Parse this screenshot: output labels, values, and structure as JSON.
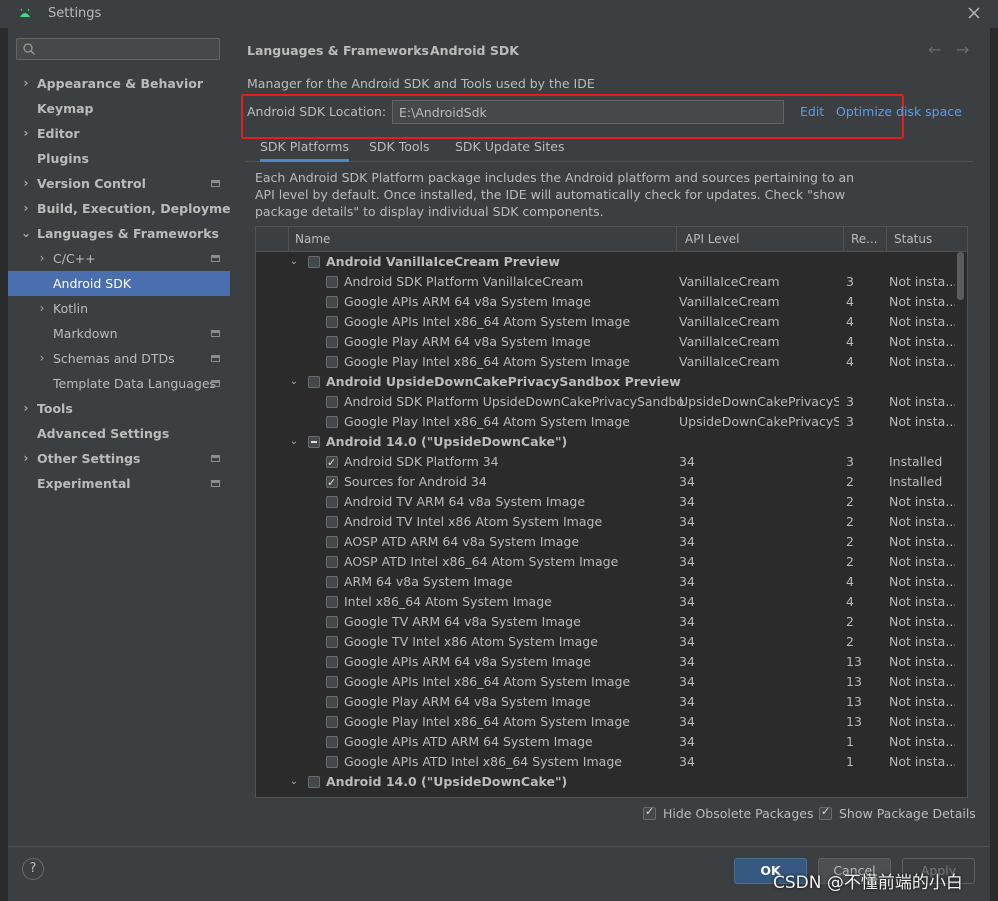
{
  "window": {
    "title": "Settings"
  },
  "search": {
    "placeholder": "",
    "value": ""
  },
  "sidebar": {
    "items": [
      {
        "label": "Appearance & Behavior",
        "level": 0,
        "bold": true,
        "expander": "›",
        "pin": false,
        "selected": false
      },
      {
        "label": "Keymap",
        "level": 0,
        "bold": true,
        "expander": "",
        "pin": false,
        "selected": false
      },
      {
        "label": "Editor",
        "level": 0,
        "bold": true,
        "expander": "›",
        "pin": false,
        "selected": false
      },
      {
        "label": "Plugins",
        "level": 0,
        "bold": true,
        "expander": "",
        "pin": false,
        "selected": false
      },
      {
        "label": "Version Control",
        "level": 0,
        "bold": true,
        "expander": "›",
        "pin": true,
        "selected": false
      },
      {
        "label": "Build, Execution, Deployment",
        "level": 0,
        "bold": true,
        "expander": "›",
        "pin": false,
        "selected": false
      },
      {
        "label": "Languages & Frameworks",
        "level": 0,
        "bold": true,
        "expander": "⌄",
        "pin": false,
        "selected": false
      },
      {
        "label": "C/C++",
        "level": 1,
        "bold": false,
        "expander": "›",
        "pin": true,
        "selected": false
      },
      {
        "label": "Android SDK",
        "level": 1,
        "bold": false,
        "expander": "",
        "pin": false,
        "selected": true
      },
      {
        "label": "Kotlin",
        "level": 1,
        "bold": false,
        "expander": "›",
        "pin": false,
        "selected": false
      },
      {
        "label": "Markdown",
        "level": 1,
        "bold": false,
        "expander": "",
        "pin": true,
        "selected": false
      },
      {
        "label": "Schemas and DTDs",
        "level": 1,
        "bold": false,
        "expander": "›",
        "pin": true,
        "selected": false
      },
      {
        "label": "Template Data Languages",
        "level": 1,
        "bold": false,
        "expander": "",
        "pin": true,
        "selected": false
      },
      {
        "label": "Tools",
        "level": 0,
        "bold": true,
        "expander": "›",
        "pin": false,
        "selected": false
      },
      {
        "label": "Advanced Settings",
        "level": 0,
        "bold": true,
        "expander": "",
        "pin": false,
        "selected": false
      },
      {
        "label": "Other Settings",
        "level": 0,
        "bold": true,
        "expander": "›",
        "pin": true,
        "selected": false
      },
      {
        "label": "Experimental",
        "level": 0,
        "bold": true,
        "expander": "",
        "pin": true,
        "selected": false
      }
    ]
  },
  "breadcrumb": {
    "parent": "Languages & Frameworks",
    "separator": "›",
    "current": "Android SDK"
  },
  "header": {
    "back_icon": "←",
    "forward_icon": "→"
  },
  "sdk": {
    "description": "Manager for the Android SDK and Tools used by the IDE",
    "location_label": "Android SDK Location:",
    "location_value": "E:\\AndroidSdk",
    "edit_link": "Edit",
    "optimize_link": "Optimize disk space"
  },
  "tabs": [
    {
      "label": "SDK Platforms",
      "active": true
    },
    {
      "label": "SDK Tools",
      "active": false
    },
    {
      "label": "SDK Update Sites",
      "active": false
    }
  ],
  "info_text": "Each Android SDK Platform package includes the Android platform and sources pertaining to an API level by default. Once installed, the IDE will automatically check for updates. Check \"show package details\" to display individual SDK components.",
  "table": {
    "columns": {
      "name": "Name",
      "api": "API Level",
      "rev": "Re...",
      "status": "Status"
    },
    "rows": [
      {
        "type": "group",
        "name": "Android VanillaIceCream Preview",
        "check": "none"
      },
      {
        "type": "item",
        "name": "Android SDK Platform VanillaIceCream",
        "api": "VanillaIceCream",
        "rev": "3",
        "status": "Not insta...",
        "check": "none"
      },
      {
        "type": "item",
        "name": "Google APIs ARM 64 v8a System Image",
        "api": "VanillaIceCream",
        "rev": "4",
        "status": "Not insta...",
        "check": "none"
      },
      {
        "type": "item",
        "name": "Google APIs Intel x86_64 Atom System Image",
        "api": "VanillaIceCream",
        "rev": "4",
        "status": "Not insta...",
        "check": "none"
      },
      {
        "type": "item",
        "name": "Google Play ARM 64 v8a System Image",
        "api": "VanillaIceCream",
        "rev": "4",
        "status": "Not insta...",
        "check": "none"
      },
      {
        "type": "item",
        "name": "Google Play Intel x86_64 Atom System Image",
        "api": "VanillaIceCream",
        "rev": "4",
        "status": "Not insta...",
        "check": "none"
      },
      {
        "type": "group",
        "name": "Android UpsideDownCakePrivacySandbox Preview",
        "check": "none"
      },
      {
        "type": "item",
        "name": "Android SDK Platform UpsideDownCakePrivacySandbox",
        "api": "UpsideDownCakePrivacyS...",
        "rev": "3",
        "status": "Not insta...",
        "check": "none"
      },
      {
        "type": "item",
        "name": "Google Play Intel x86_64 Atom System Image",
        "api": "UpsideDownCakePrivacyS...",
        "rev": "3",
        "status": "Not insta...",
        "check": "none"
      },
      {
        "type": "group",
        "name": "Android 14.0 (\"UpsideDownCake\")",
        "check": "partial"
      },
      {
        "type": "item",
        "name": "Android SDK Platform 34",
        "api": "34",
        "rev": "3",
        "status": "Installed",
        "check": "checked"
      },
      {
        "type": "item",
        "name": "Sources for Android 34",
        "api": "34",
        "rev": "2",
        "status": "Installed",
        "check": "checked"
      },
      {
        "type": "item",
        "name": "Android TV ARM 64 v8a System Image",
        "api": "34",
        "rev": "2",
        "status": "Not insta...",
        "check": "none"
      },
      {
        "type": "item",
        "name": "Android TV Intel x86 Atom System Image",
        "api": "34",
        "rev": "2",
        "status": "Not insta...",
        "check": "none"
      },
      {
        "type": "item",
        "name": "AOSP ATD ARM 64 v8a System Image",
        "api": "34",
        "rev": "2",
        "status": "Not insta...",
        "check": "none"
      },
      {
        "type": "item",
        "name": "AOSP ATD Intel x86_64 Atom System Image",
        "api": "34",
        "rev": "2",
        "status": "Not insta...",
        "check": "none"
      },
      {
        "type": "item",
        "name": "ARM 64 v8a System Image",
        "api": "34",
        "rev": "4",
        "status": "Not insta...",
        "check": "none"
      },
      {
        "type": "item",
        "name": "Intel x86_64 Atom System Image",
        "api": "34",
        "rev": "4",
        "status": "Not insta...",
        "check": "none"
      },
      {
        "type": "item",
        "name": "Google TV ARM 64 v8a System Image",
        "api": "34",
        "rev": "2",
        "status": "Not insta...",
        "check": "none"
      },
      {
        "type": "item",
        "name": "Google TV Intel x86 Atom System Image",
        "api": "34",
        "rev": "2",
        "status": "Not insta...",
        "check": "none"
      },
      {
        "type": "item",
        "name": "Google APIs ARM 64 v8a System Image",
        "api": "34",
        "rev": "13",
        "status": "Not insta...",
        "check": "none"
      },
      {
        "type": "item",
        "name": "Google APIs Intel x86_64 Atom System Image",
        "api": "34",
        "rev": "13",
        "status": "Not insta...",
        "check": "none"
      },
      {
        "type": "item",
        "name": "Google Play ARM 64 v8a System Image",
        "api": "34",
        "rev": "13",
        "status": "Not insta...",
        "check": "none"
      },
      {
        "type": "item",
        "name": "Google Play Intel x86_64 Atom System Image",
        "api": "34",
        "rev": "13",
        "status": "Not insta...",
        "check": "none"
      },
      {
        "type": "item",
        "name": "Google APIs ATD ARM 64 System Image",
        "api": "34",
        "rev": "1",
        "status": "Not insta...",
        "check": "none"
      },
      {
        "type": "item",
        "name": "Google APIs ATD Intel x86_64 System Image",
        "api": "34",
        "rev": "1",
        "status": "Not insta...",
        "check": "none"
      },
      {
        "type": "group",
        "name": "Android 14.0 (\"UpsideDownCake\")",
        "check": "none"
      }
    ]
  },
  "options": {
    "hide_obsolete": "Hide Obsolete Packages",
    "show_details": "Show Package Details"
  },
  "footer": {
    "help": "?",
    "ok": "OK",
    "cancel": "Cancel",
    "apply": "Apply"
  },
  "watermark": "CSDN @不懂前端的小白",
  "colors": {
    "accent": "#4b6eaf",
    "link": "#589df6",
    "highlight_box": "#e02020",
    "ok_button": "#365880"
  }
}
